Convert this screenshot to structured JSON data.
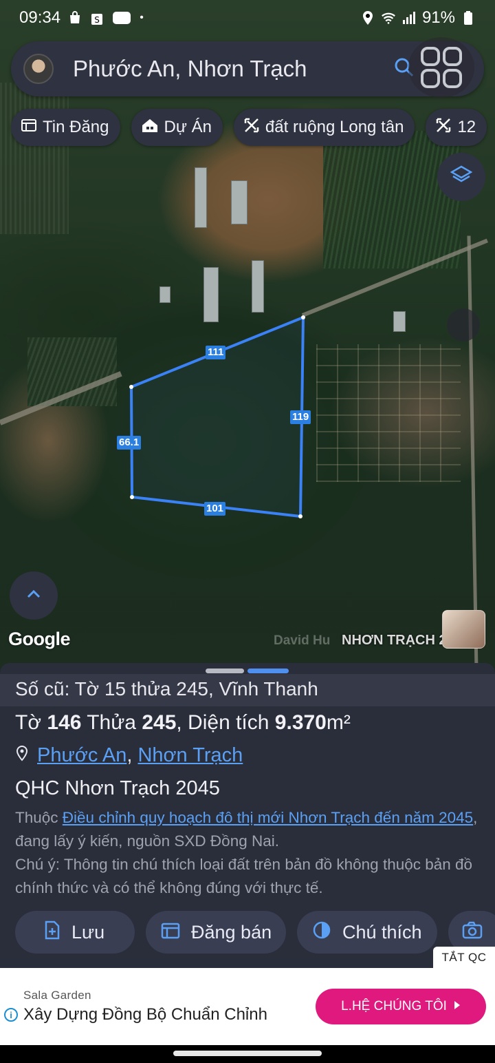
{
  "status_bar": {
    "time": "09:34",
    "battery": "91%",
    "icons": [
      "shopping-bag-icon",
      "shopee-icon",
      "zalo-icon",
      "dot-icon",
      "location-icon",
      "wifi-icon",
      "signal-icon",
      "battery-icon"
    ],
    "zalo_label": "Zalo"
  },
  "search": {
    "query": "Phước An, Nhơn Trạch"
  },
  "chips": [
    {
      "label": "Tin Đăng",
      "icon": "listing-icon"
    },
    {
      "label": "Dự Án",
      "icon": "project-icon"
    },
    {
      "label": "đất ruộng Long tân",
      "icon": "measure-icon"
    },
    {
      "label": "12",
      "icon": "measure-icon"
    }
  ],
  "map": {
    "edge_labels": {
      "top": "111",
      "right": "119",
      "left": "66.1",
      "bottom": "101"
    },
    "google_logo": "Google",
    "watermark": "David Hu",
    "brand_tag": "NHƠN TRẠCH 2045",
    "parcel_color": "#3b82f6"
  },
  "sheet": {
    "old_line": "Số cũ: Tờ 15 thửa 245, Vĩnh Thanh",
    "title_to_label": "Tờ",
    "title_to_value": "146",
    "title_thua_label": "Thửa",
    "title_thua_value": "245",
    "title_area_label": ", Diện tích",
    "title_area_value": "9.370",
    "title_area_unit": "m²",
    "location_ward": "Phước An",
    "location_sep": ",",
    "location_district": "Nhơn Trạch",
    "qhc_title": "QHC Nhơn Trạch 2045",
    "desc_prefix": "Thuộc ",
    "desc_link": "Điều chỉnh quy hoạch đô thị mới Nhơn Trạch đến năm 2045",
    "desc_suffix": ", đang lấy ý kiến, nguồn SXD Đồng Nai.",
    "note": "Chú ý: Thông tin chú thích loại đất trên bản đồ không thuộc bản đồ chính thức và có thể không đúng với thực tế.",
    "actions": [
      {
        "label": "Lưu",
        "icon": "save-add-icon"
      },
      {
        "label": "Đăng bán",
        "icon": "calendar-icon"
      },
      {
        "label": "Chú thích",
        "icon": "contrast-icon"
      },
      {
        "label": "",
        "icon": "camera-add-icon"
      }
    ],
    "tat_qc": "TẮT QC"
  },
  "ad": {
    "advertiser": "Sala Garden",
    "headline": "Xây Dựng Đồng Bộ Chuẩn Chỉnh",
    "cta": "L.HỆ CHÚNG TÔI",
    "cta_color": "#e0197e"
  }
}
